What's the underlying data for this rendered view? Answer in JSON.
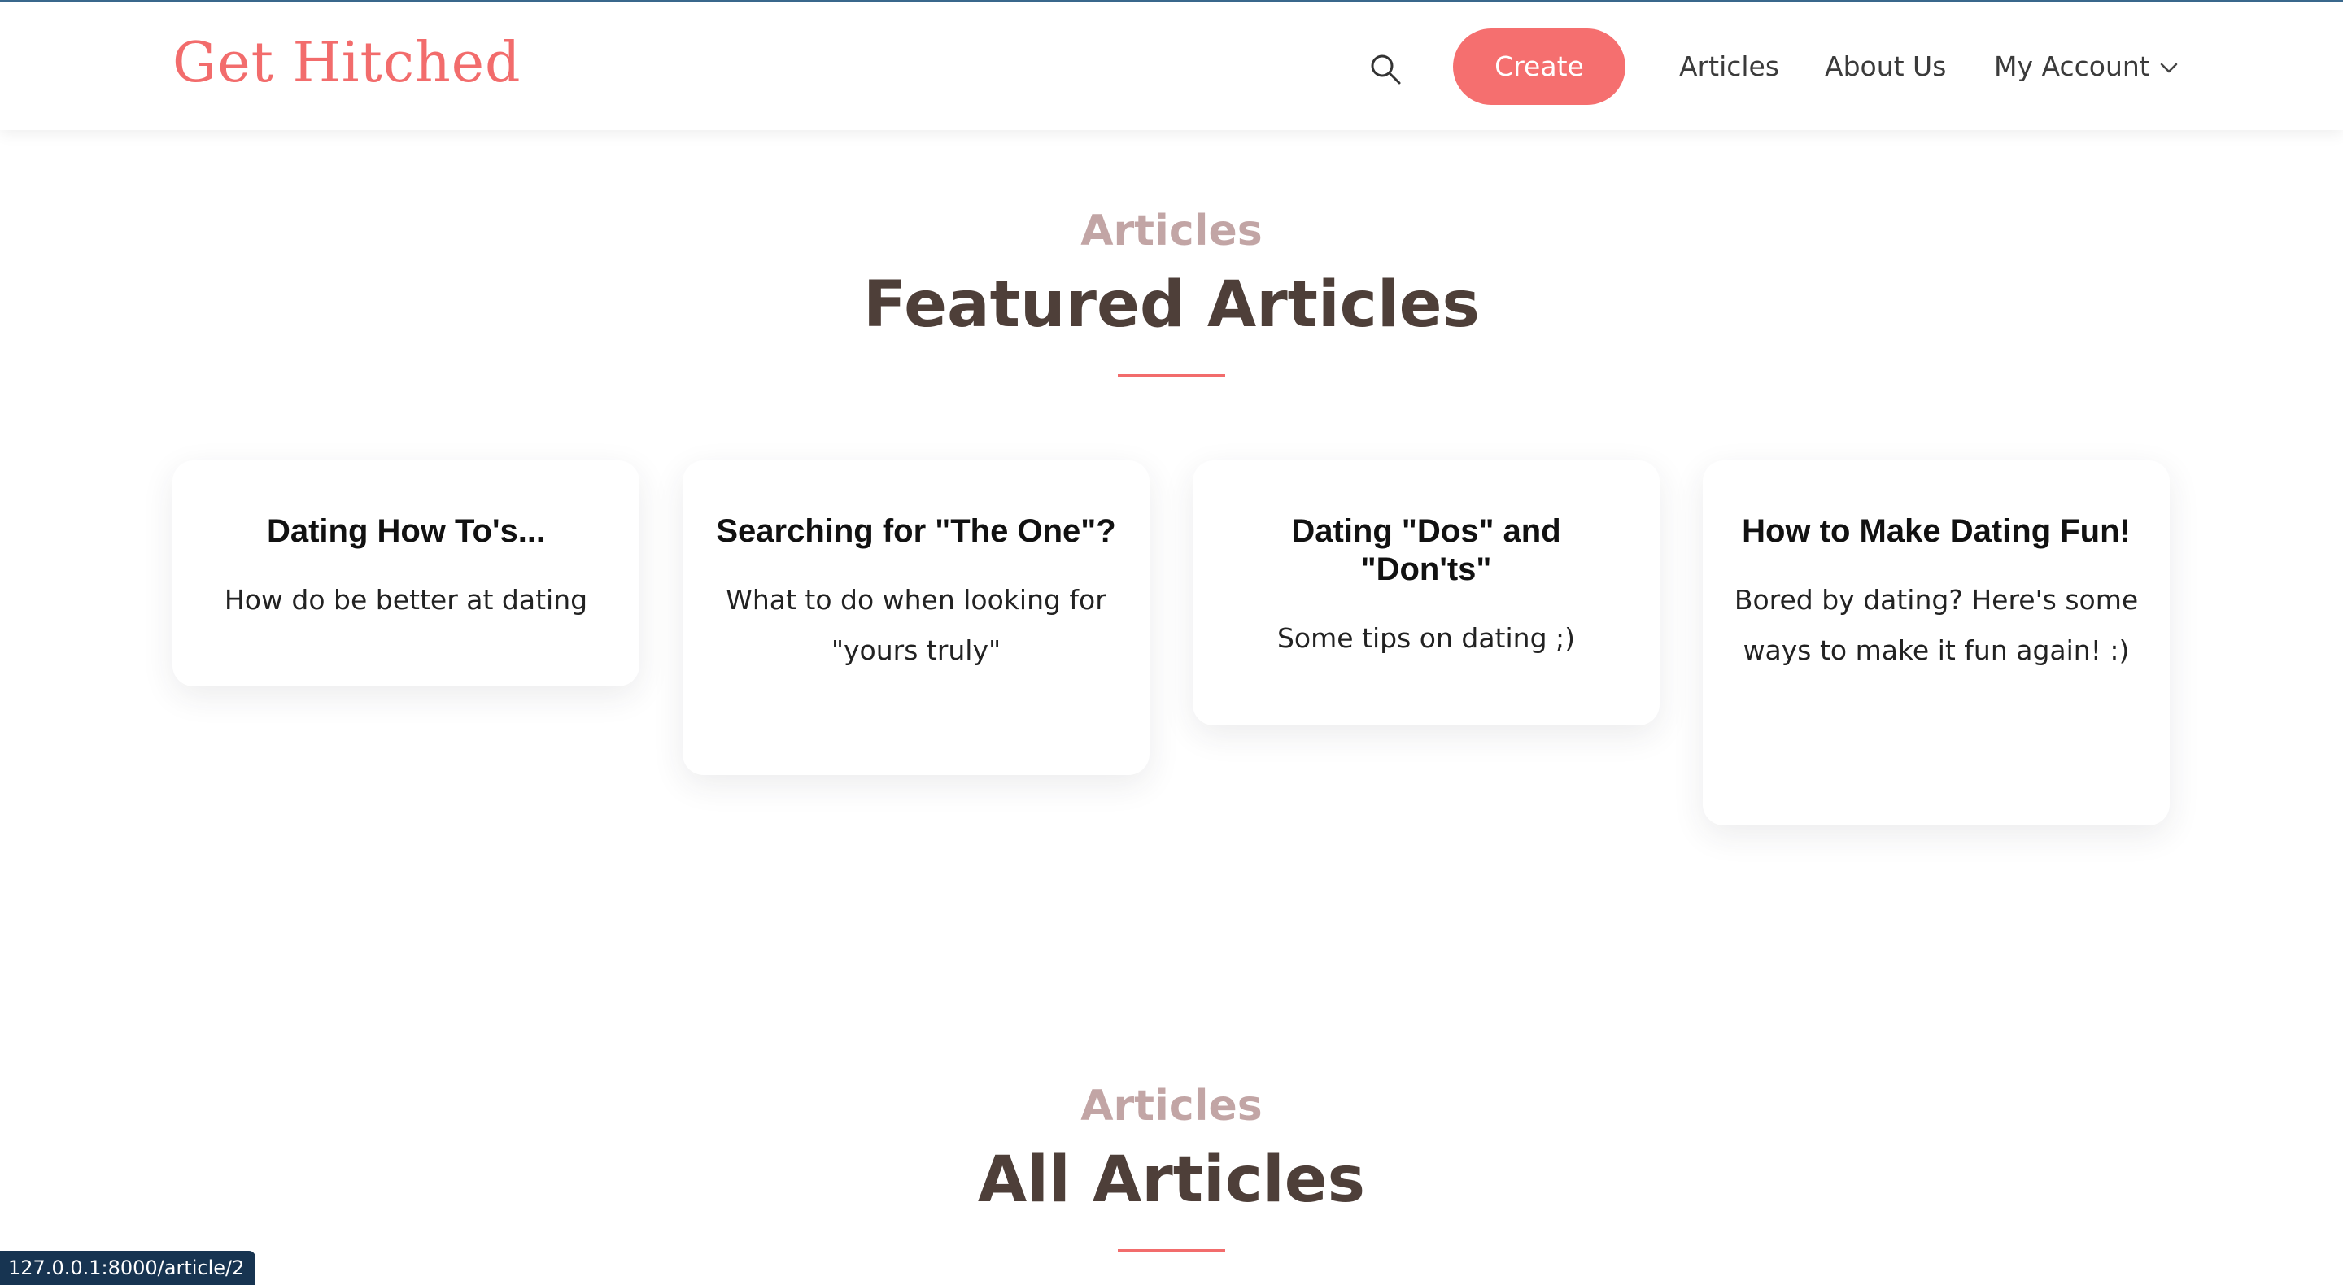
{
  "header": {
    "logo": "Get Hitched",
    "create_label": "Create",
    "nav": [
      "Articles",
      "About Us",
      "My Account"
    ]
  },
  "icons": {
    "search": "search-icon",
    "account_dropdown": "chevron-down-icon"
  },
  "featured": {
    "subtitle": "Articles",
    "title": "Featured Articles",
    "cards": [
      {
        "title": "Dating How To's...",
        "description": "How do be better at dating"
      },
      {
        "title": "Searching for \"The One\"?",
        "description": "What to do when looking for \"yours truly\""
      },
      {
        "title": "Dating \"Dos\" and \"Don'ts\"",
        "description": "Some tips on dating ;)"
      },
      {
        "title": "How to Make Dating Fun!",
        "description": "Bored by dating? Here's some ways to make it fun again! :)"
      }
    ]
  },
  "all_articles": {
    "subtitle": "Articles",
    "title": "All Articles"
  },
  "status_bar": {
    "url": "127.0.0.1:8000/article/2"
  },
  "colors": {
    "brand": "#f26c6c",
    "heading": "#4e3f39",
    "subheading": "#c2a5a5"
  }
}
